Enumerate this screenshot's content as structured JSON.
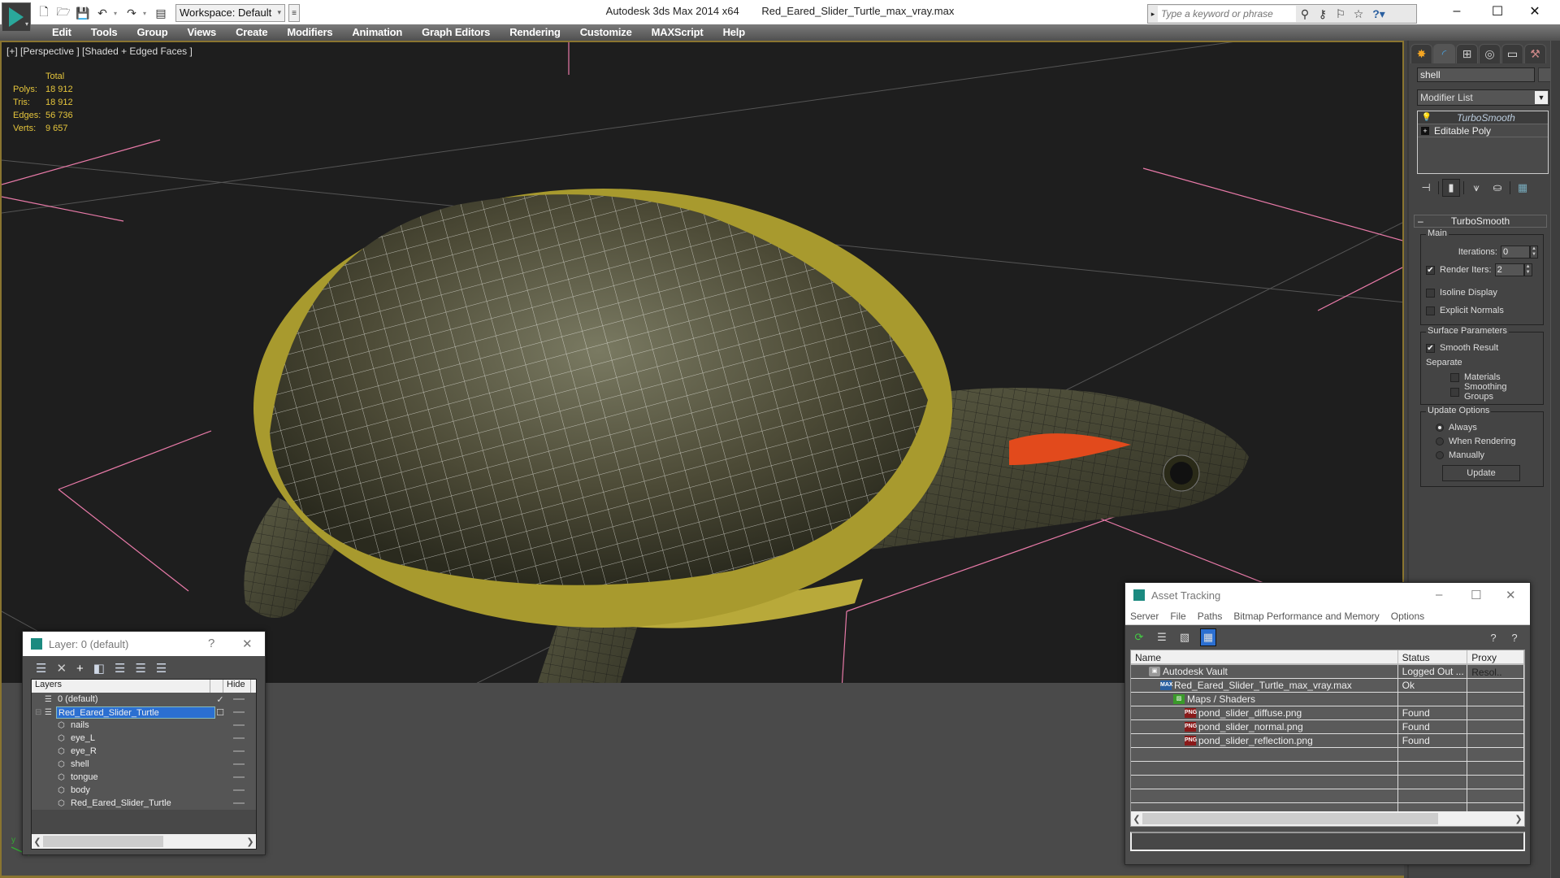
{
  "app": {
    "title": "Autodesk 3ds Max  2014 x64",
    "file": "Red_Eared_Slider_Turtle_max_vray.max",
    "workspace": "Workspace: Default",
    "search_placeholder": "Type a keyword or phrase",
    "icons": [
      "new-file-icon",
      "open-folder-icon",
      "save-icon",
      "undo-icon",
      "redo-icon",
      "project-icon"
    ],
    "search_icons": [
      "binoculars-icon",
      "key-icon",
      "satellite-icon",
      "star-icon"
    ]
  },
  "menu": [
    "Edit",
    "Tools",
    "Group",
    "Views",
    "Create",
    "Modifiers",
    "Animation",
    "Graph Editors",
    "Rendering",
    "Customize",
    "MAXScript",
    "Help"
  ],
  "viewport": {
    "label": "[+] [Perspective ] [Shaded + Edged Faces ]",
    "stats_header": "Total",
    "stats": [
      {
        "k": "Polys:",
        "v": "18 912"
      },
      {
        "k": "Tris:",
        "v": "18 912"
      },
      {
        "k": "Edges:",
        "v": "56 736"
      },
      {
        "k": "Verts:",
        "v": "9 657"
      }
    ],
    "axis_label": "y"
  },
  "command_panel": {
    "tabs": [
      "create",
      "modify",
      "hierarchy",
      "motion",
      "display",
      "utilities"
    ],
    "object_name": "shell",
    "modifier_list": "Modifier List",
    "stack": [
      {
        "label": "TurboSmooth",
        "selected": true
      },
      {
        "label": "Editable Poly",
        "selected": false
      }
    ],
    "rollout": {
      "title": "TurboSmooth",
      "main_group": "Main",
      "iterations_label": "Iterations:",
      "iterations_value": "0",
      "render_iters_label": "Render Iters:",
      "render_iters_value": "2",
      "render_iters_checked": true,
      "isoline_label": "Isoline Display",
      "explicit_normals_label": "Explicit Normals",
      "surface_group": "Surface Parameters",
      "smooth_result_label": "Smooth Result",
      "separate_label": "Separate",
      "materials_label": "Materials",
      "smoothing_groups_label": "Smoothing Groups",
      "update_group": "Update Options",
      "always_label": "Always",
      "when_rendering_label": "When Rendering",
      "manually_label": "Manually",
      "update_button": "Update"
    }
  },
  "layer_dialog": {
    "title": "Layer: 0 (default)",
    "help": "?",
    "col_layers": "Layers",
    "col_hide": "Hide",
    "rows": [
      {
        "name": "0 (default)",
        "level": 0,
        "checked": true,
        "selected": false
      },
      {
        "name": "Red_Eared_Slider_Turtle",
        "level": 0,
        "checked": false,
        "selected": true
      },
      {
        "name": "nails",
        "level": 1
      },
      {
        "name": "eye_L",
        "level": 1
      },
      {
        "name": "eye_R",
        "level": 1
      },
      {
        "name": "shell",
        "level": 1
      },
      {
        "name": "tongue",
        "level": 1
      },
      {
        "name": "body",
        "level": 1
      },
      {
        "name": "Red_Eared_Slider_Turtle",
        "level": 1
      }
    ]
  },
  "asset_dialog": {
    "title": "Asset Tracking",
    "menu": [
      "Server",
      "File",
      "Paths",
      "Bitmap Performance and Memory",
      "Options"
    ],
    "columns": [
      "Name",
      "Status",
      "Proxy Resol.."
    ],
    "rows": [
      {
        "name": "Autodesk Vault",
        "status": "Logged Out ...",
        "icon": "vault",
        "level": 1
      },
      {
        "name": "Red_Eared_Slider_Turtle_max_vray.max",
        "status": "Ok",
        "icon": "max",
        "level": 2
      },
      {
        "name": "Maps / Shaders",
        "status": "",
        "icon": "maps",
        "level": 3
      },
      {
        "name": "pond_slider_diffuse.png",
        "status": "Found",
        "icon": "png",
        "level": 4
      },
      {
        "name": "pond_slider_normal.png",
        "status": "Found",
        "icon": "png",
        "level": 4
      },
      {
        "name": "pond_slider_reflection.png",
        "status": "Found",
        "icon": "png",
        "level": 4
      }
    ],
    "empty_rows": 6
  }
}
